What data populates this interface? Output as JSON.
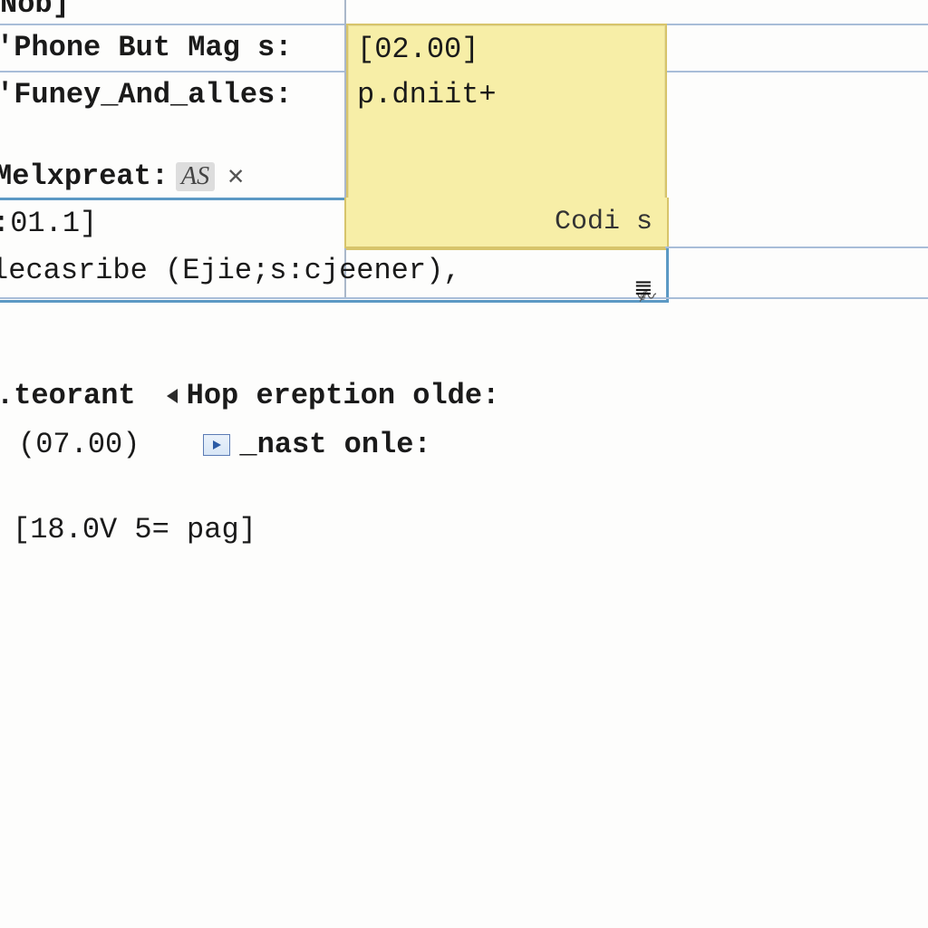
{
  "rows": {
    "r0_label": "Nob]",
    "r1_label": "'Phone But Mag s:",
    "r1_value": "[02.00]",
    "r2_label": "'Funey_And_alles:",
    "r2_value": "p.dniit+",
    "r3_label": "Melxpreat:",
    "r3_badge": "AS",
    "r4_value": ":01.1]",
    "r5_value": "lecasribe (Ejie;s:cjeener),"
  },
  "popup": {
    "label": "Codi s"
  },
  "section2": {
    "teorant": ".teorant",
    "hop": "Hop ereption olde:",
    "paren": "(07.00)",
    "nast": "_nast onle:",
    "bracket": "[18.0V 5= pag]"
  }
}
